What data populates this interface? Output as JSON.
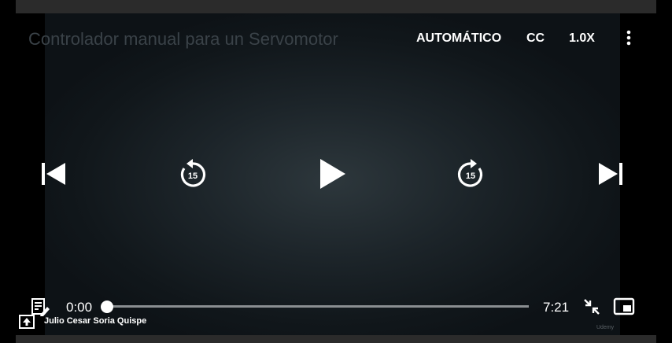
{
  "player": {
    "title": "Controlador manual para un Servomotor",
    "quality_label": "AUTOMÁTICO",
    "captions_label": "CC",
    "speed_label": "1.0X",
    "current_time": "0:00",
    "duration": "7:21",
    "progress": 0,
    "skip_seconds_back": "15",
    "skip_seconds_forward": "15",
    "instructor": "Julio Cesar Soria Quispe",
    "watermark": "Udemy"
  },
  "colors": {
    "icon": "#ffffff",
    "track": "#8a8e91",
    "frame": "#2b2b2b"
  }
}
